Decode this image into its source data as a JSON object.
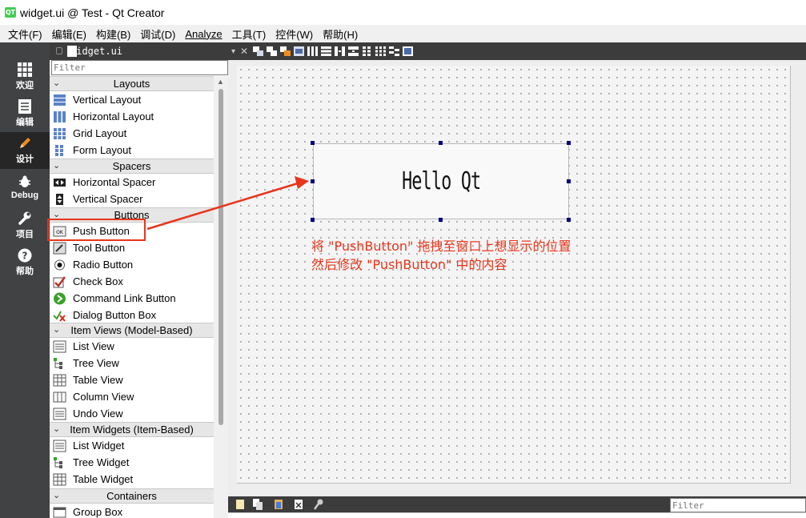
{
  "window": {
    "title": "widget.ui @ Test - Qt Creator",
    "logo_text": "QT"
  },
  "menubar": {
    "items": [
      "文件(F)",
      "编辑(E)",
      "构建(B)",
      "调试(D)",
      "Analyze",
      "工具(T)",
      "控件(W)",
      "帮助(H)"
    ]
  },
  "modebar": {
    "modes": [
      {
        "label": "欢迎",
        "icon": "grid-icon"
      },
      {
        "label": "编辑",
        "icon": "document-icon"
      },
      {
        "label": "设计",
        "icon": "pencil-icon",
        "active": true
      },
      {
        "label": "Debug",
        "icon": "bug-icon"
      },
      {
        "label": "项目",
        "icon": "wrench-icon"
      },
      {
        "label": "帮助",
        "icon": "help-icon"
      }
    ]
  },
  "widget_box": {
    "file_name": "widget.ui",
    "filter_placeholder": "Filter",
    "categories": {
      "layouts": "Layouts",
      "spacers": "Spacers",
      "buttons": "Buttons",
      "item_views": "Item Views (Model-Based)",
      "item_widgets": "Item Widgets (Item-Based)",
      "containers": "Containers"
    },
    "items": {
      "vertical_layout": "Vertical Layout",
      "horizontal_layout": "Horizontal Layout",
      "grid_layout": "Grid Layout",
      "form_layout": "Form Layout",
      "horizontal_spacer": "Horizontal Spacer",
      "vertical_spacer": "Vertical Spacer",
      "push_button": "Push Button",
      "tool_button": "Tool Button",
      "radio_button": "Radio Button",
      "check_box": "Check Box",
      "command_link_button": "Command Link Button",
      "dialog_button_box": "Dialog Button Box",
      "list_view": "List View",
      "tree_view": "Tree View",
      "table_view": "Table View",
      "column_view": "Column View",
      "undo_view": "Undo View",
      "list_widget": "List Widget",
      "tree_widget": "Tree Widget",
      "table_widget": "Table Widget",
      "group_box": "Group Box"
    }
  },
  "form": {
    "push_button_text": "Hello Qt",
    "annotation_line1": "将 \"PushButton\" 拖拽至窗口上想显示的位置",
    "annotation_line2": "然后修改 \"PushButton\" 中的内容"
  },
  "bottom": {
    "filter_placeholder": "Filter"
  },
  "colors": {
    "annotation_red": "#e8351c",
    "modebar": "#404244",
    "selection_handle": "#00007f"
  }
}
